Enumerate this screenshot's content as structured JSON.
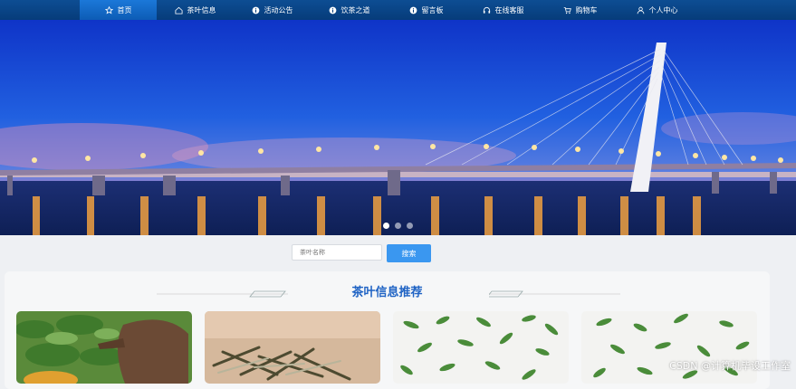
{
  "nav": {
    "items": [
      {
        "label": "首页",
        "icon": "star-icon"
      },
      {
        "label": "茶叶信息",
        "icon": "home-icon"
      },
      {
        "label": "活动公告",
        "icon": "info-icon"
      },
      {
        "label": "饮茶之道",
        "icon": "info-icon"
      },
      {
        "label": "留言板",
        "icon": "info-icon"
      },
      {
        "label": "在线客服",
        "icon": "headset-icon"
      },
      {
        "label": "购物车",
        "icon": "cart-icon"
      },
      {
        "label": "个人中心",
        "icon": "user-icon"
      }
    ],
    "active_index": 0
  },
  "carousel": {
    "slide_count": 3,
    "active_index": 0
  },
  "search": {
    "placeholder": "茶叶名称",
    "button_label": "搜索"
  },
  "section": {
    "title": "茶叶信息推荐"
  },
  "watermark": "CSDN @计算机毕设工作室",
  "colors": {
    "nav_bg": "#063c7a",
    "nav_active": "#1b78d9",
    "accent": "#3a97f0",
    "title": "#1f63c4"
  }
}
